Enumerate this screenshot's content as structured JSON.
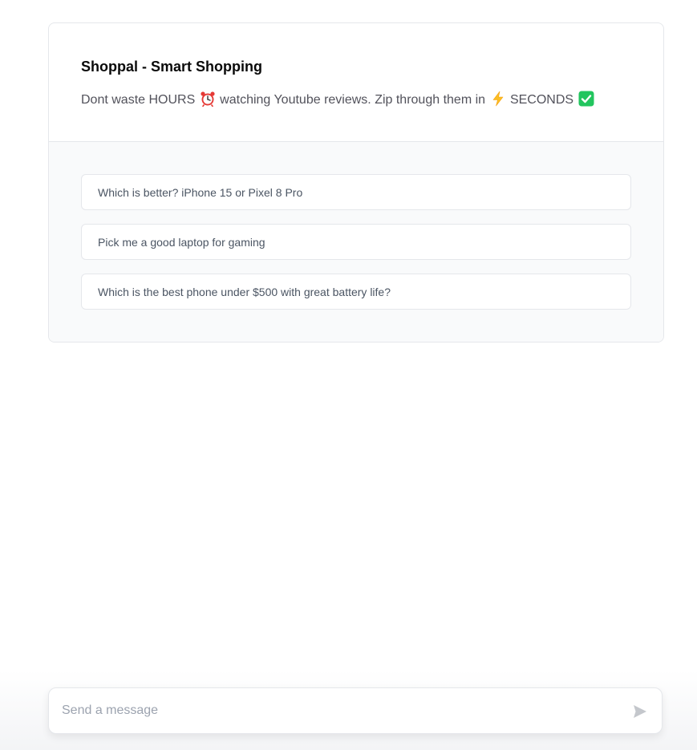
{
  "welcome": {
    "title": "Shoppal - Smart Shopping",
    "subtitle_parts": {
      "part1": "Dont waste HOURS",
      "part2": "watching Youtube reviews. Zip through them in",
      "part3": "SECONDS"
    },
    "icons": [
      "alarm-clock-icon",
      "lightning-icon",
      "check-mark-icon"
    ]
  },
  "examples": [
    {
      "label": "Which is better? iPhone 15 or Pixel 8 Pro"
    },
    {
      "label": "Pick me a good laptop for gaming"
    },
    {
      "label": "Which is the best phone under $500 with great battery life?"
    }
  ],
  "composer": {
    "placeholder": "Send a message",
    "value": "",
    "send_icon": "send-icon"
  },
  "colors": {
    "border": "#e5e7eb",
    "examples_bg": "#f9fafb",
    "text_muted": "#52525b",
    "check_green": "#22c55e",
    "alarm_red": "#e53935",
    "lightning_yellow": "#fbbf24"
  }
}
